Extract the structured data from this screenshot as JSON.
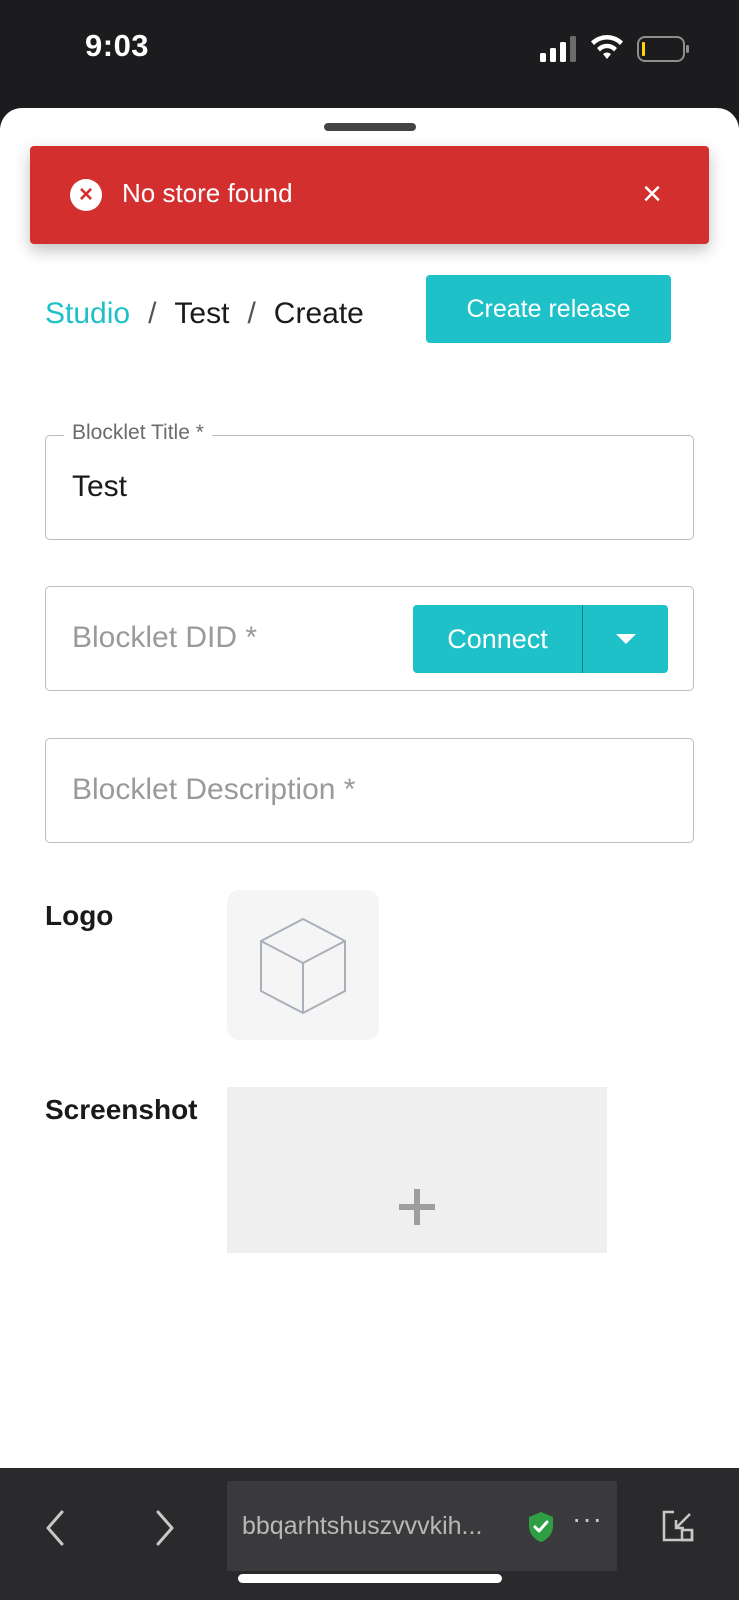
{
  "status_bar": {
    "time": "9:03"
  },
  "toast": {
    "message": "No store found",
    "type": "error",
    "color": "#d32f2f",
    "icon": "error-circle-icon",
    "close_label": "×"
  },
  "breadcrumb": {
    "items": [
      "Studio",
      "Test",
      "Create"
    ],
    "separator": "/"
  },
  "header": {
    "create_release_label": "Create release"
  },
  "form": {
    "title": {
      "label": "Blocklet Title *",
      "value": "Test"
    },
    "did": {
      "placeholder": "Blocklet DID *",
      "connect_label": "Connect"
    },
    "description": {
      "placeholder": "Blocklet Description *"
    },
    "logo_label": "Logo",
    "screenshot_label": "Screenshot"
  },
  "browser": {
    "url": "bbqarhtshuszvvvkih...",
    "more_label": "···"
  },
  "colors": {
    "accent": "#1fc1c8",
    "error": "#d32f2f",
    "secure": "#2ea043"
  }
}
